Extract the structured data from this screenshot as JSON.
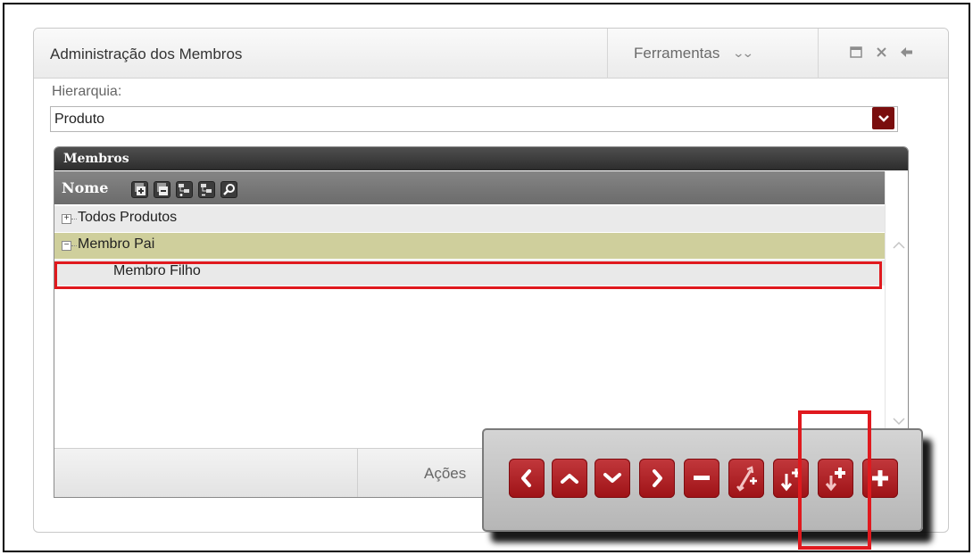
{
  "panel": {
    "title": "Administração dos Membros",
    "tools_label": "Ferramentas"
  },
  "hierarchy": {
    "label": "Hierarquia:",
    "selected": "Produto"
  },
  "members": {
    "title": "Membros",
    "column_label": "Nome",
    "rows": [
      {
        "label": "Todos Produtos",
        "expander": "+"
      },
      {
        "label": "Membro Pai",
        "expander": "−"
      },
      {
        "label": "Membro Filho",
        "expander": ""
      }
    ],
    "footer_label": "Ações"
  },
  "colors": {
    "accent_red": "#b0262a",
    "select_arrow": "#7a0e0e",
    "selected_row": "#cfcf9c",
    "highlight": "#e0191e"
  },
  "icons": {
    "toolbar": [
      "expand-all-icon",
      "collapse-all-icon",
      "add-level-icon",
      "remove-level-icon",
      "search-icon"
    ],
    "actions": [
      "move-left-icon",
      "move-up-icon",
      "move-down-icon",
      "move-right-icon",
      "remove-icon",
      "swap-icon",
      "insert-before-icon",
      "insert-child-icon",
      "add-icon"
    ]
  }
}
